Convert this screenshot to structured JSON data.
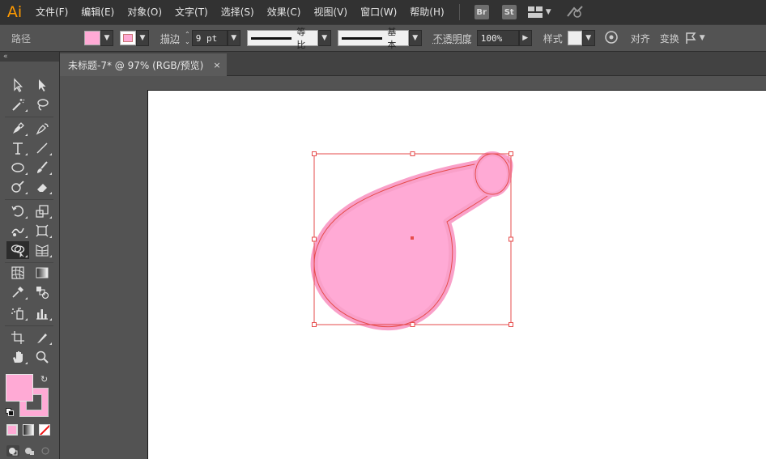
{
  "app": {
    "logo": "Ai"
  },
  "menu": [
    "文件(F)",
    "编辑(E)",
    "对象(O)",
    "文字(T)",
    "选择(S)",
    "效果(C)",
    "视图(V)",
    "窗口(W)",
    "帮助(H)"
  ],
  "app_buttons": [
    "Br",
    "St"
  ],
  "control": {
    "object_type": "路径",
    "stroke_label": "描边",
    "stroke_weight": "9 pt",
    "profile_label": "等比",
    "brush_label": "基本",
    "opacity_label": "不透明度",
    "opacity_value": "100%",
    "style_label": "样式",
    "align_label": "对齐",
    "transform_label": "变换"
  },
  "document": {
    "tab_title": "未标题-7* @ 97% (RGB/预览)",
    "close": "×"
  },
  "colors": {
    "fill": "#ffaad5",
    "stroke": "#ffaad5",
    "selection": "#e64b4b",
    "panel": "#535353"
  }
}
